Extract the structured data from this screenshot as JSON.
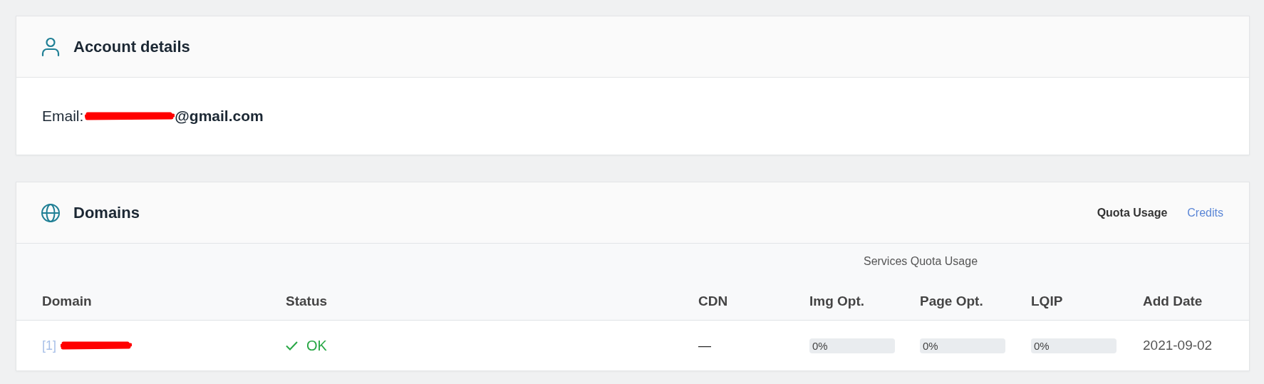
{
  "account": {
    "title": "Account details",
    "email_label": "Email:",
    "email_visible": "@gmail.com"
  },
  "domains": {
    "title": "Domains",
    "tabs": [
      {
        "label": "Quota Usage",
        "selected": true
      },
      {
        "label": "Credits",
        "selected": false
      }
    ],
    "group_heading": "Services Quota Usage",
    "columns": [
      "Domain",
      "Status",
      "CDN",
      "Img Opt.",
      "Page Opt.",
      "LQIP",
      "Add Date"
    ],
    "rows": [
      {
        "index": "[1]",
        "status": {
          "kind": "ok",
          "text": "OK"
        },
        "cdn": "—",
        "quotas": [
          {
            "reading": "0%",
            "level": 0
          },
          {
            "reading": "0%",
            "level": 0
          },
          {
            "reading": "0%",
            "level": 0
          }
        ],
        "add_date": "2021-09-02"
      }
    ]
  }
}
